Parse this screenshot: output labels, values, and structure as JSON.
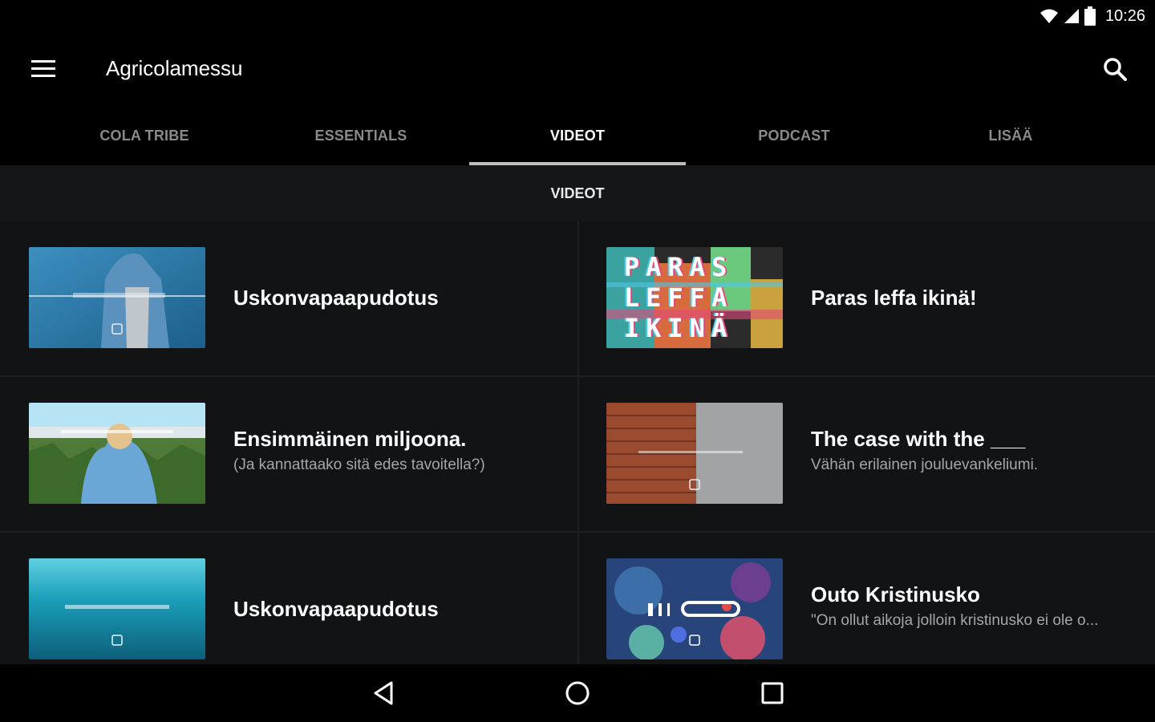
{
  "status": {
    "time": "10:26"
  },
  "app_bar": {
    "title": "Agricolamessu"
  },
  "tabs": [
    {
      "label": "COLA TRIBE"
    },
    {
      "label": "ESSENTIALS"
    },
    {
      "label": "VIDEOT"
    },
    {
      "label": "PODCAST"
    },
    {
      "label": "LISÄÄ"
    }
  ],
  "active_tab": "VIDEOT",
  "section": {
    "title": "VIDEOT"
  },
  "videos": [
    {
      "title": "Uskonvapaapudotus",
      "subtitle": ""
    },
    {
      "title": "Paras leffa ikinä!",
      "subtitle": "",
      "thumb_text": "PARAS LEFFA IKINÄ"
    },
    {
      "title": "Ensimmäinen miljoona.",
      "subtitle": "(Ja kannattaako sitä edes tavoitella?)"
    },
    {
      "title": "The case with the ___",
      "subtitle": "Vähän erilainen jouluevankeliumi."
    },
    {
      "title": "Uskonvapaapudotus",
      "subtitle": ""
    },
    {
      "title": "Outo Kristinusko",
      "subtitle": "\"On ollut aikoja jolloin kristinusko ei ole o..."
    }
  ],
  "colors": {
    "accent_indicator": "#bdbdbd",
    "background": "#121315"
  },
  "icons": [
    "menu-icon",
    "search-icon",
    "wifi-icon",
    "signal-icon",
    "battery-icon",
    "back-icon",
    "home-icon",
    "recents-icon"
  ]
}
